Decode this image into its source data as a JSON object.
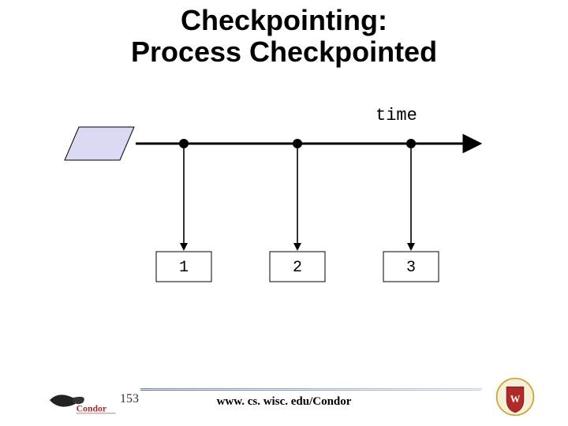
{
  "title_line1": "Checkpointing:",
  "title_line2": "Process Checkpointed",
  "axis_label": "time",
  "checkpoints": [
    "1",
    "2",
    "3"
  ],
  "slide_number": "153",
  "footer_url": "www. cs. wisc. edu/Condor",
  "logos": {
    "left": "condor-logo",
    "right": "uw-madison-crest"
  },
  "colors": {
    "shape_fill": "#d9d9f3",
    "stroke": "#000000",
    "rule_a": "#6a8abf",
    "rule_b": "#3f5a8c"
  },
  "chart_data": {
    "type": "timeline",
    "title": "Checkpointing: Process Checkpointed",
    "axis": "time",
    "process_span": {
      "start": 0,
      "end": 0.15
    },
    "arrow_span": {
      "start": 0.15,
      "end": 1.0
    },
    "checkpoint_events": [
      {
        "label": "1",
        "position": 0.3
      },
      {
        "label": "2",
        "position": 0.58
      },
      {
        "label": "3",
        "position": 0.86
      }
    ]
  }
}
